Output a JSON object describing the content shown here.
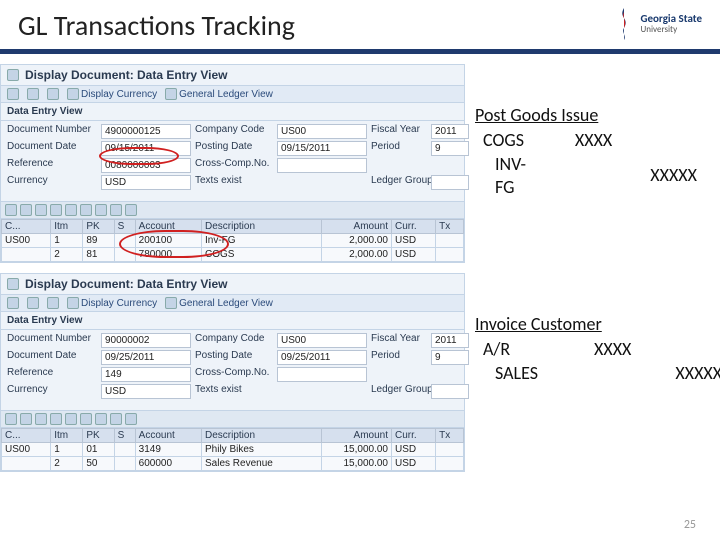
{
  "header": {
    "title": "GL Transactions Tracking",
    "logo_uni": "Georgia State",
    "logo_sub": "University"
  },
  "panel1": {
    "heading": "Display Document: Data Entry View",
    "tb_display_currency": "Display Currency",
    "tb_glview": "General Ledger View",
    "data_view": "Data Entry View",
    "labels": {
      "docnum": "Document Number",
      "cc": "Company Code",
      "fy": "Fiscal Year",
      "docdate": "Document Date",
      "pdate": "Posting Date",
      "period": "Period",
      "ref": "Reference",
      "ccn": "Cross-Comp.No.",
      "curr": "Currency",
      "texts": "Texts exist",
      "lgroup": "Ledger Group"
    },
    "values": {
      "docnum": "4900000125",
      "cc": "US00",
      "fy": "2011",
      "docdate": "09/15/2011",
      "pdate": "09/15/2011",
      "period": "9",
      "ref": "0080000003",
      "curr": "USD"
    },
    "cols": {
      "c0": "C...",
      "c1": "Itm",
      "c2": "PK",
      "c3": "S",
      "c4": "Account",
      "c5": "Description",
      "c6": "Amount",
      "c7": "Curr.",
      "c8": "Tx"
    },
    "rows": [
      {
        "c0": "US00",
        "c1": "1",
        "c2": "89",
        "c4": "200100",
        "c5": "Inv-FG",
        "c6": "2,000.00",
        "c7": "USD"
      },
      {
        "c0": "",
        "c1": "2",
        "c2": "81",
        "c4": "780000",
        "c5": "COGS",
        "c6": "2,000.00",
        "c7": "USD"
      }
    ]
  },
  "panel2": {
    "heading": "Display Document: Data Entry View",
    "tb_display_currency": "Display Currency",
    "tb_glview": "General Ledger View",
    "data_view": "Data Entry View",
    "labels": {
      "docnum": "Document Number",
      "cc": "Company Code",
      "fy": "Fiscal Year",
      "docdate": "Document Date",
      "pdate": "Posting Date",
      "period": "Period",
      "ref": "Reference",
      "ccn": "Cross-Comp.No.",
      "curr": "Currency",
      "texts": "Texts exist",
      "lgroup": "Ledger Group"
    },
    "values": {
      "docnum": "90000002",
      "cc": "US00",
      "fy": "2011",
      "docdate": "09/25/2011",
      "pdate": "09/25/2011",
      "period": "9",
      "ref": "149",
      "curr": "USD"
    },
    "cols": {
      "c0": "C...",
      "c1": "Itm",
      "c2": "PK",
      "c3": "S",
      "c4": "Account",
      "c5": "Description",
      "c6": "Amount",
      "c7": "Curr.",
      "c8": "Tx"
    },
    "rows": [
      {
        "c0": "US00",
        "c1": "1",
        "c2": "01",
        "c4": "3149",
        "c5": "Phily Bikes",
        "c6": "15,000.00",
        "c7": "USD"
      },
      {
        "c0": "",
        "c1": "2",
        "c2": "50",
        "c4": "600000",
        "c5": "Sales Revenue",
        "c6": "15,000.00",
        "c7": "USD"
      }
    ]
  },
  "side1": {
    "title": "Post Goods Issue",
    "r1a": "COGS",
    "r1b": "XXXX",
    "r2a": "INV-FG",
    "r2b": "XXXXX"
  },
  "side2": {
    "title": "Invoice Customer",
    "r1a": "A/R",
    "r1b": "XXXX",
    "r2a": "SALES",
    "r2b": "XXXXX"
  },
  "page": "25"
}
